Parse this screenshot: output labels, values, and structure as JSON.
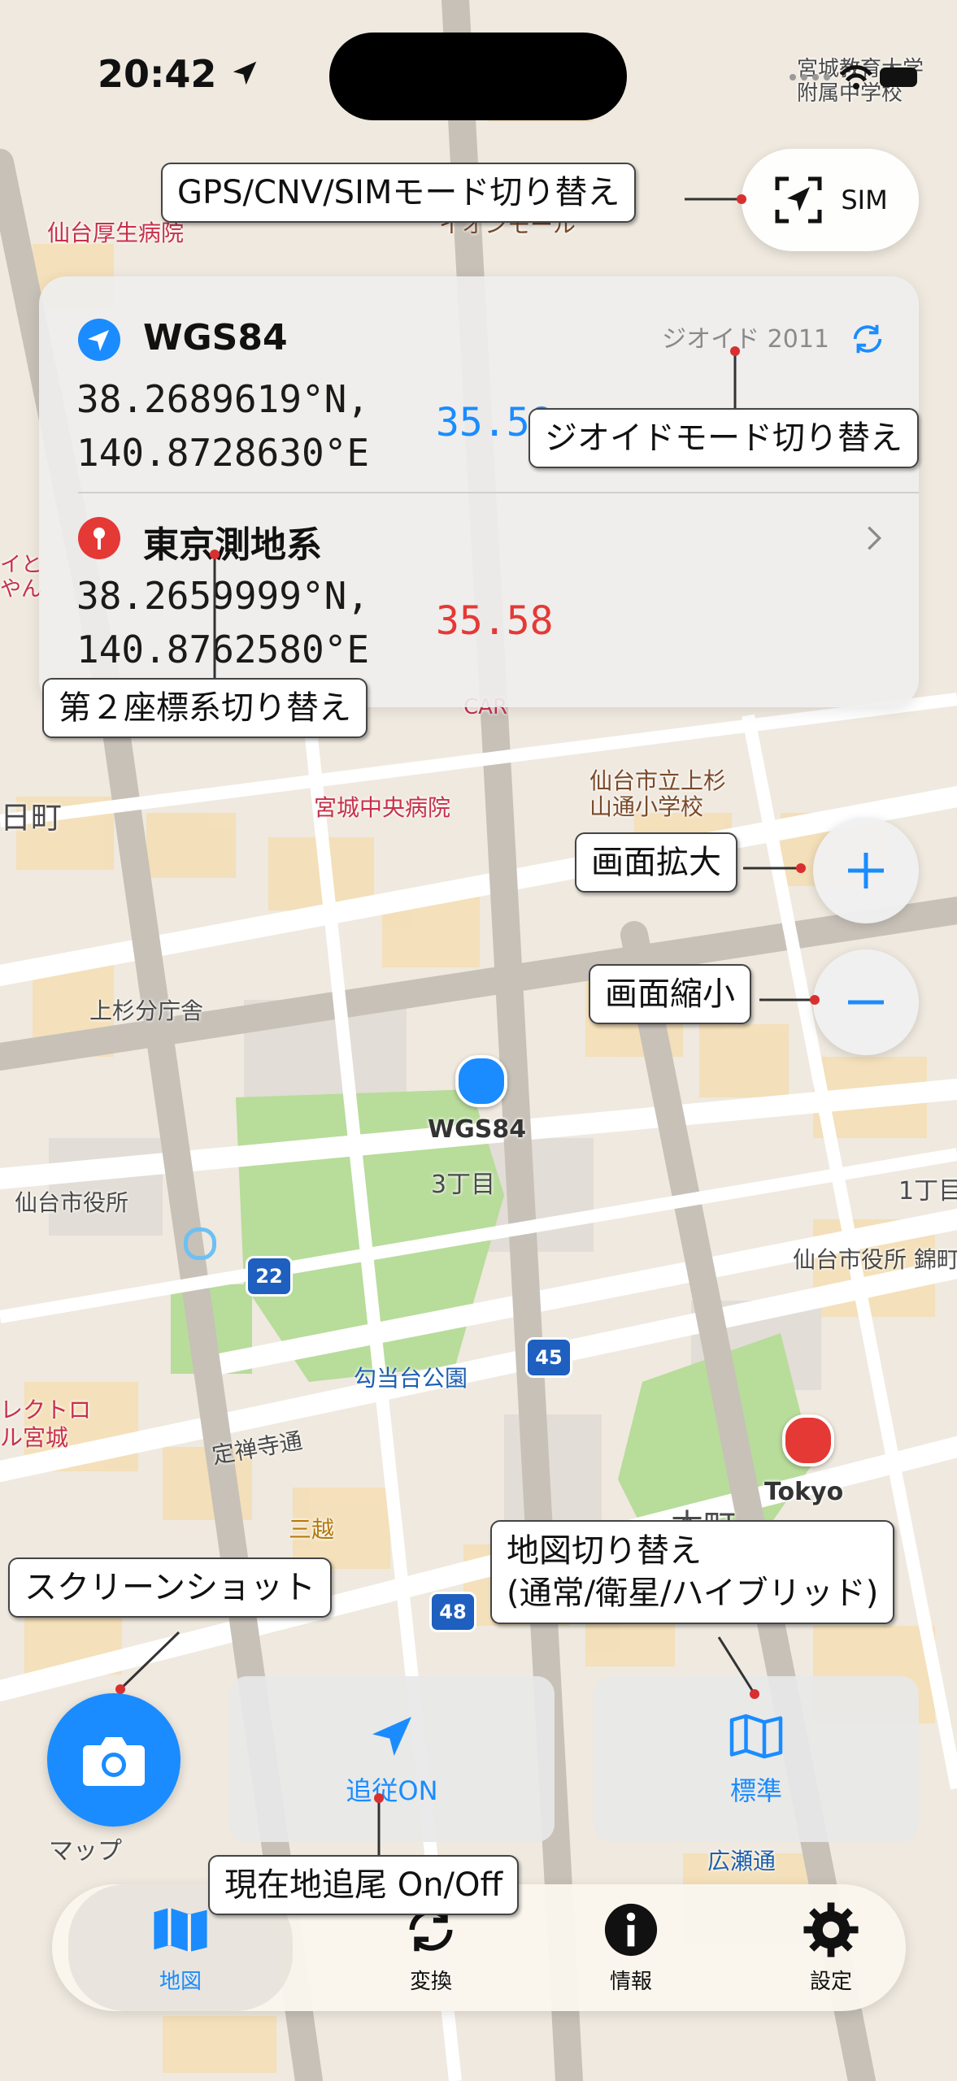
{
  "status_bar": {
    "time": "20:42"
  },
  "mode_button": {
    "label": "SIM",
    "icon": "location-arrow-icon"
  },
  "coordinates": {
    "primary": {
      "system": "WGS84",
      "lat": "38.2689619°N,",
      "lon": "140.8728630°E",
      "altitude": "35.58",
      "geoid_label": "ジオイド 2011"
    },
    "secondary": {
      "system": "東京測地系",
      "lat": "38.2659999°N,",
      "lon": "140.8762580°E",
      "altitude": "35.58"
    }
  },
  "callouts": {
    "mode_switch": "GPS/CNV/SIMモード切り替え",
    "geoid_switch": "ジオイドモード切り替え",
    "second_system": "第２座標系切り替え",
    "zoom_in": "画面拡大",
    "zoom_out": "画面縮小",
    "screenshot": "スクリーンショット",
    "map_switch_line1": "地図切り替え",
    "map_switch_line2": "(通常/衛星/ハイブリッド)",
    "tracking": "現在地追尾 On/Off"
  },
  "map": {
    "markers": {
      "wgs84": "WGS84",
      "tokyo": "Tokyo"
    },
    "labels": {
      "hospital1": "仙台厚生病院",
      "aeon": "イオンモール",
      "school_top": "宮城教育大学\n附属中学校",
      "hospital2": "宮城中央病院",
      "school2": "仙台市立上杉\n山通小学校",
      "kamisugi": "上杉分庁舎",
      "cityhall": "仙台市役所",
      "cityhall2": "仙台市役所 錦町",
      "chome3": "3丁目",
      "chome1": "1丁目",
      "park": "勾当台公園",
      "jozenji": "定禅寺通",
      "mitsukoshi": "三越",
      "honcho": "本町",
      "hirose": "広瀬通",
      "machi": "日町",
      "route22": "22",
      "route45": "45",
      "route48": "48",
      "mymap": "マップ",
      "electro": "レクトロ\nル宮城",
      "car": "CAR",
      "nishi": "イと\nやん"
    }
  },
  "controls": {
    "follow_label": "追従ON",
    "map_type_label": "標準"
  },
  "tabs": [
    {
      "label": "地図",
      "icon": "map-icon"
    },
    {
      "label": "変換",
      "icon": "convert-icon"
    },
    {
      "label": "情報",
      "icon": "info-icon"
    },
    {
      "label": "設定",
      "icon": "gear-icon"
    }
  ],
  "colors": {
    "accent": "#1a8cff",
    "tokyo": "#e53935",
    "callout_dot": "#d83030"
  }
}
